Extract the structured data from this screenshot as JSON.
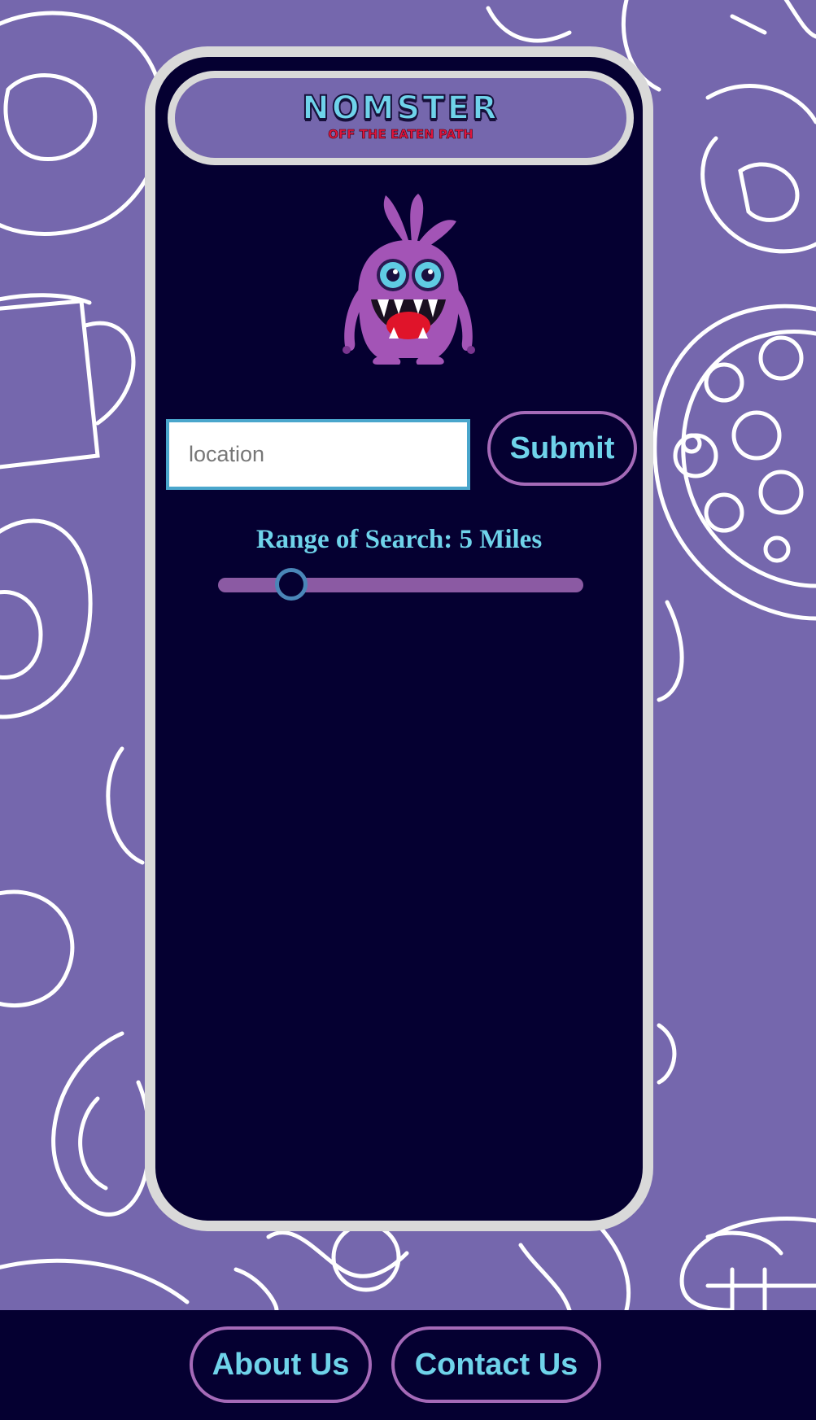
{
  "app": {
    "title": "NOMSTER",
    "tagline": "OFF THE EATEN PATH"
  },
  "search": {
    "placeholder": "location",
    "value": "",
    "submit_label": "Submit"
  },
  "range": {
    "label": "Range of Search: 5 Miles",
    "value_miles": 5,
    "fraction": 0.2
  },
  "footer": {
    "about_label": "About Us",
    "contact_label": "Contact Us"
  },
  "colors": {
    "background": "#7567ad",
    "panel": "#050031",
    "frame": "#d9d9d9",
    "accent_text": "#6fd3ea",
    "button_border": "#a56ab8",
    "slider_track": "#8b5aa3",
    "tagline": "#e0143c"
  },
  "icons": {
    "mascot": "purple-monster-mascot"
  }
}
